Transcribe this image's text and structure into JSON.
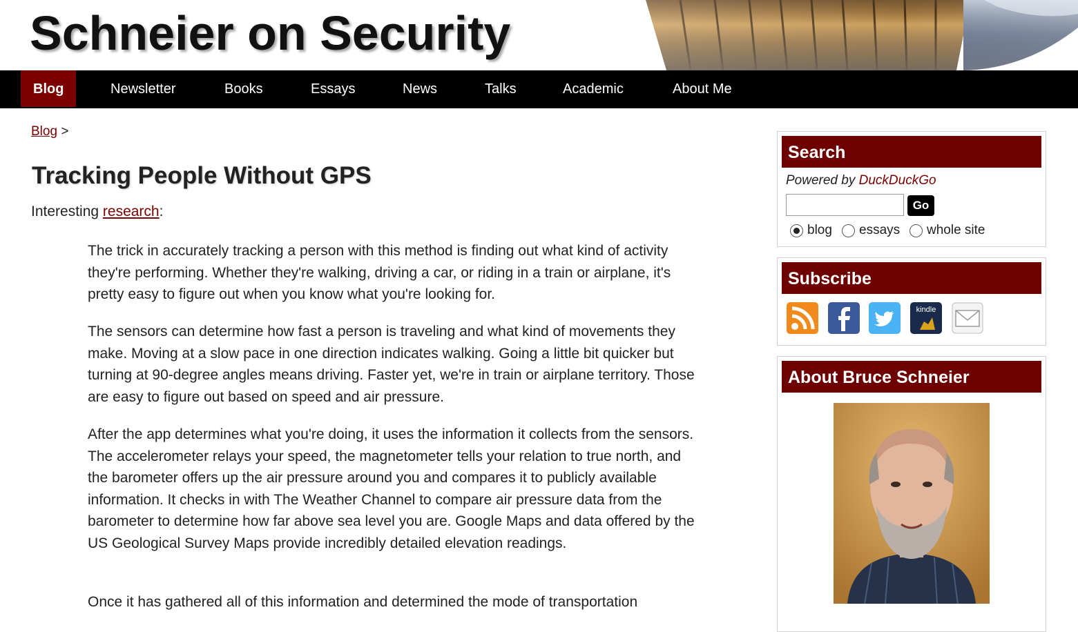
{
  "header": {
    "title": "Schneier on Security"
  },
  "nav": {
    "items": [
      "Blog",
      "Newsletter",
      "Books",
      "Essays",
      "News",
      "Talks",
      "Academic",
      "About Me"
    ],
    "active": "Blog"
  },
  "breadcrumb": {
    "link": "Blog",
    "separator": ">"
  },
  "post": {
    "title": "Tracking People Without GPS",
    "intro_prefix": "Interesting ",
    "intro_link": "research",
    "intro_suffix": ":",
    "quotes": [
      "The trick in accurately tracking a person with this method is finding out what kind of activity they're performing. Whether they're walking, driving a car, or riding in a train or airplane, it's pretty easy to figure out when you know what you're looking for.",
      "The sensors can determine how fast a person is traveling and what kind of movements they make. Moving at a slow pace in one direction indicates walking. Going a little bit quicker but turning at 90-degree angles means driving. Faster yet, we're in train or airplane territory. Those are easy to figure out based on speed and air pressure.",
      "After the app determines what you're doing, it uses the information it collects from the sensors. The accelerometer relays your speed, the magnetometer tells your relation to true north, and the barometer offers up the air pressure around you and compares it to publicly available information. It checks in with The Weather Channel to compare air pressure data from the barometer to determine how far above sea level you are. Google Maps and data offered by the US Geological Survey Maps provide incredibly detailed elevation readings.",
      "Once it has gathered all of this information and determined the mode of transportation"
    ]
  },
  "sidebar": {
    "search": {
      "heading": "Search",
      "powered_prefix": "Powered by ",
      "powered_link": "DuckDuckGo",
      "go_label": "Go",
      "input_value": "",
      "scopes": [
        "blog",
        "essays",
        "whole site"
      ],
      "selected_scope": "blog"
    },
    "subscribe": {
      "heading": "Subscribe",
      "icons": [
        "rss-icon",
        "facebook-icon",
        "twitter-icon",
        "kindle-icon",
        "email-icon"
      ],
      "kindle_text": "kindle"
    },
    "about": {
      "heading": "About Bruce Schneier"
    }
  },
  "colors": {
    "accent": "#7b0000",
    "nav_bg": "#000000",
    "widget_head": "#6e0000"
  }
}
